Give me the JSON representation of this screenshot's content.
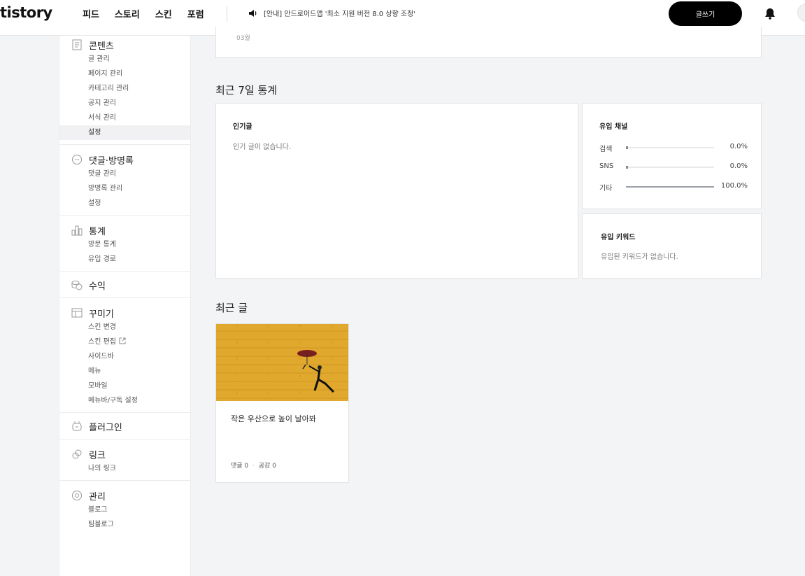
{
  "header": {
    "logo": "tistory",
    "nav": [
      "피드",
      "스토리",
      "스킨",
      "포럼"
    ],
    "notice": "[안내] 안드로이드앱 '최소 지원 버전 8.0 상향 조정'",
    "write_button": "글쓰기"
  },
  "sidebar": {
    "groups": [
      {
        "title": "콘텐츠",
        "icon": "document-icon",
        "items": [
          "글 관리",
          "페이지 관리",
          "카테고리 관리",
          "공지 관리",
          "서식 관리",
          "설정"
        ],
        "active": 5
      },
      {
        "title": "댓글·방명록",
        "icon": "comment-icon",
        "items": [
          "댓글 관리",
          "방명록 관리",
          "설정"
        ]
      },
      {
        "title": "통계",
        "icon": "chart-icon",
        "items": [
          "방문 통계",
          "유입 경로"
        ]
      },
      {
        "title": "수익",
        "icon": "coin-icon",
        "items": []
      },
      {
        "title": "꾸미기",
        "icon": "layout-icon",
        "items": [
          "스킨 변경",
          "스킨 편집",
          "사이드바",
          "메뉴",
          "모바일",
          "메뉴바/구독 설정"
        ]
      },
      {
        "title": "플러그인",
        "icon": "plugin-icon",
        "items": []
      },
      {
        "title": "링크",
        "icon": "link-icon",
        "items": [
          "나의 링크"
        ]
      },
      {
        "title": "관리",
        "icon": "gear-icon",
        "items": [
          "블로그",
          "팀블로그"
        ]
      }
    ]
  },
  "main": {
    "top_card_label": "03월",
    "weekly_title": "최근 7일 통계",
    "popular": {
      "title": "인기글",
      "empty": "인기 글이 없습니다."
    },
    "channels": {
      "title": "유입 채널",
      "rows": [
        {
          "name": "검색",
          "percent_label": "0.0%",
          "percent": 0
        },
        {
          "name": "SNS",
          "percent_label": "0.0%",
          "percent": 0
        },
        {
          "name": "기타",
          "percent_label": "100.0%",
          "percent": 100
        }
      ]
    },
    "keywords": {
      "title": "유입 키워드",
      "empty": "유입된 키워드가 없습니다."
    },
    "recent_title": "최근 글",
    "recent_post": {
      "title": "작은 우산으로 높이 날아봐",
      "comments": "댓글 0",
      "likes": "공감 0"
    }
  },
  "colors": {
    "accent": "#000000",
    "image_bg": "#e0a92d"
  }
}
